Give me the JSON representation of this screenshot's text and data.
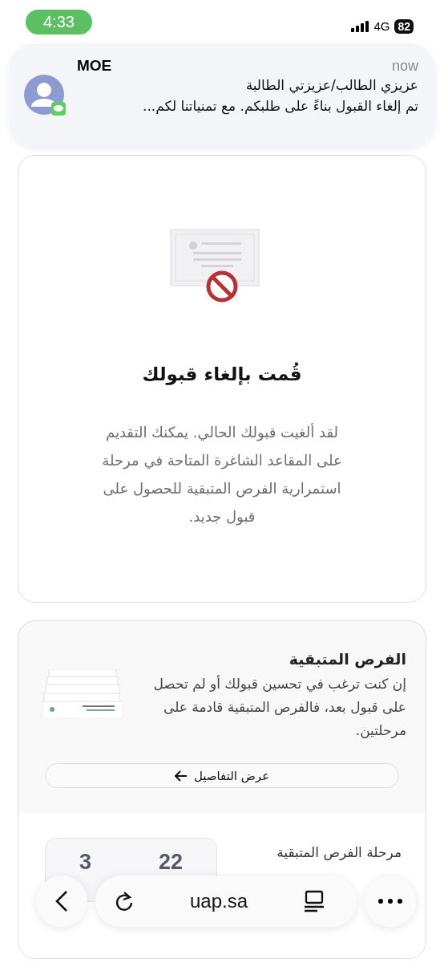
{
  "status_bar": {
    "time": "4:33",
    "network": "4G",
    "battery": "82"
  },
  "notification": {
    "app": "MOE",
    "time": "now",
    "lines": [
      "عزيزي الطالب/عزيزتي الطالبة",
      "تم إلغاء القبول بناءً على طلبكم. مع تمنياتنا لكم..."
    ]
  },
  "cancel_card": {
    "title": "قُمت بإلغاء قبولك",
    "message": "لقد ألغيت قبولك الحالي. يمكنك التقديم على المقاعد الشاغرة المتاحة في مرحلة استمرارية الفرص المتبقية للحصول على قبول جديد."
  },
  "remaining_card": {
    "title": "الفرص المتبقية",
    "description": "إن كنت ترغب في تحسين قبولك أو لم تحصل على قبول بعد، فالفرص المتبقية قادمة على مرحلتين.",
    "button": "عرض التفاصيل"
  },
  "phase": {
    "title": "مرحلة الفرص المتبقية",
    "dates": [
      "22",
      "3"
    ]
  },
  "browser_bar": {
    "url": "uap.sa"
  }
}
